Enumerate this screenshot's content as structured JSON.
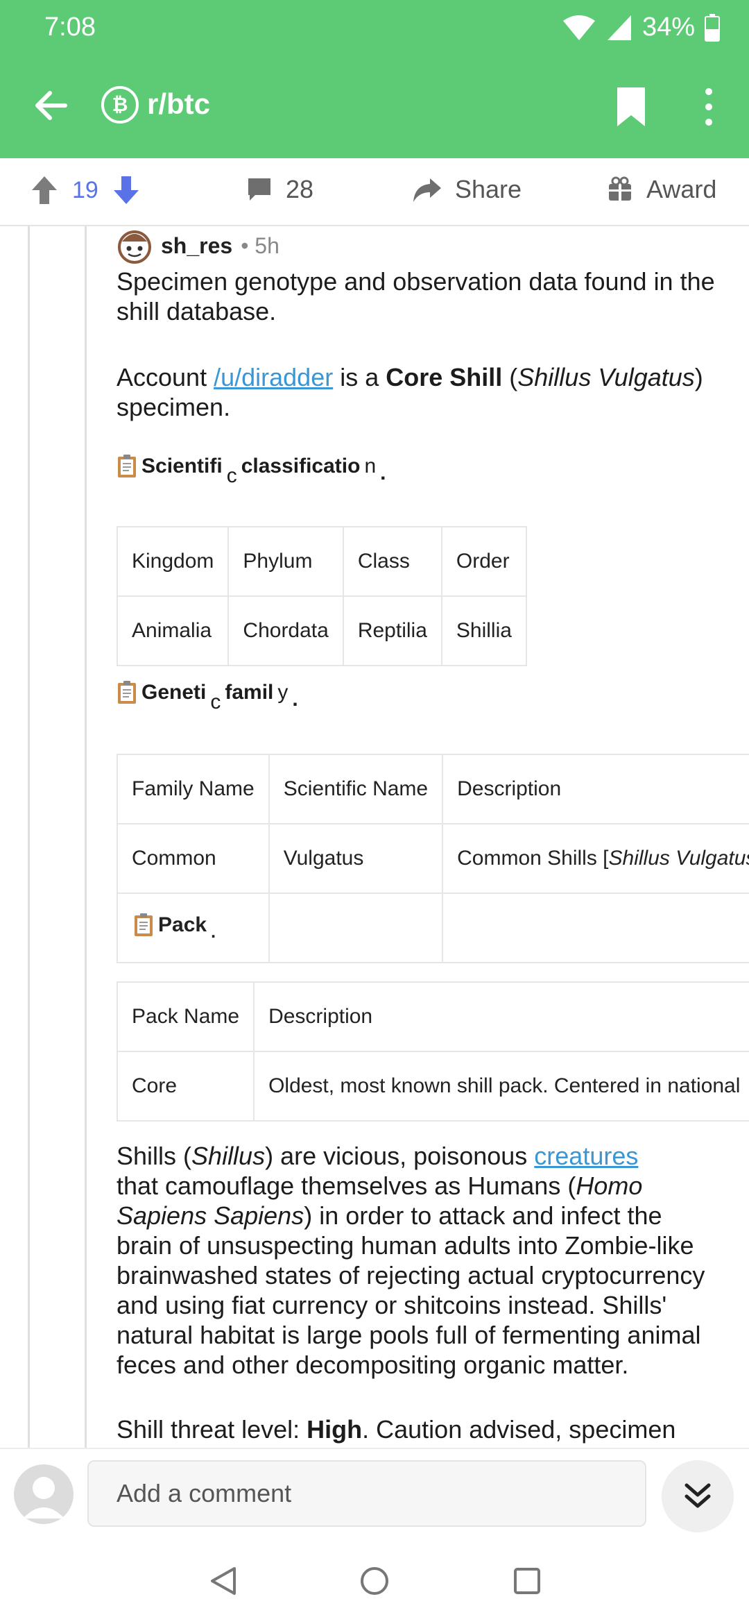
{
  "status": {
    "time": "7:08",
    "battery": "34%"
  },
  "appbar": {
    "subreddit": "r/btc",
    "icon_letter": "₿"
  },
  "actions": {
    "score": "19",
    "comments": "28",
    "share": "Share",
    "award": "Award"
  },
  "comment": {
    "author": "sh_res",
    "age": "• 5h",
    "p1": "Specimen genotype and observation data found in the shill database.",
    "p2": {
      "pre": "Account ",
      "link": "/u/diradder",
      "mid": " is a ",
      "bold": "Core Shill",
      "paren_open": " (",
      "italic": "Shillus Vulgatus",
      "post": ") specimen."
    },
    "sci_header": {
      "a": "Scientifi",
      "b": "c",
      "c": " classificatio",
      "d": "n",
      "e": "."
    },
    "classification": {
      "headers": [
        "Kingdom",
        "Phylum",
        "Class",
        "Order"
      ],
      "row": [
        "Animalia",
        "Chordata",
        "Reptilia",
        "Shillia"
      ]
    },
    "gen_header": {
      "a": "Geneti",
      "b": "c",
      "c": " famil",
      "d": "y",
      "e": "."
    },
    "family": {
      "headers": [
        "Family Name",
        "Scientific Name",
        "Description"
      ],
      "row": [
        "Common",
        "Vulgatus",
        "Common Shills [",
        "Shillus Vulgatus"
      ],
      "pack_label": "Pack",
      "pack_dot": "."
    },
    "pack": {
      "headers": [
        "Pack Name",
        "Description"
      ],
      "row": [
        "Core",
        "Oldest, most known shill pack. Centered in national"
      ]
    },
    "p3": {
      "l1a": "Shills (",
      "l1i": "Shillus",
      "l1b": ") are vicious, poisonous ",
      "l1link": "creatures",
      "l2": "that camouflage themselves as Humans (",
      "l2i": "Homo",
      "l3i": "Sapiens Sapiens",
      "l3": ") in order to attack and infect the",
      "l4": "brain of unsuspecting human adults into Zombie-like",
      "l5": "brainwashed states of rejecting actual cryptocurrency",
      "l6": "and using fiat currency or shitcoins instead. Shills'",
      "l7": "natural habitat is large pools full of fermenting animal",
      "l8": "feces and other decompositing organic matter."
    },
    "p4": {
      "pre": "Shill threat level: ",
      "bold": "High",
      "post": ". Caution advised, specimen"
    }
  },
  "input": {
    "placeholder": "Add a comment"
  },
  "colors": {
    "brand": "#5dcb75",
    "upvote_blue": "#5a72e8",
    "link": "#3a97d4"
  }
}
